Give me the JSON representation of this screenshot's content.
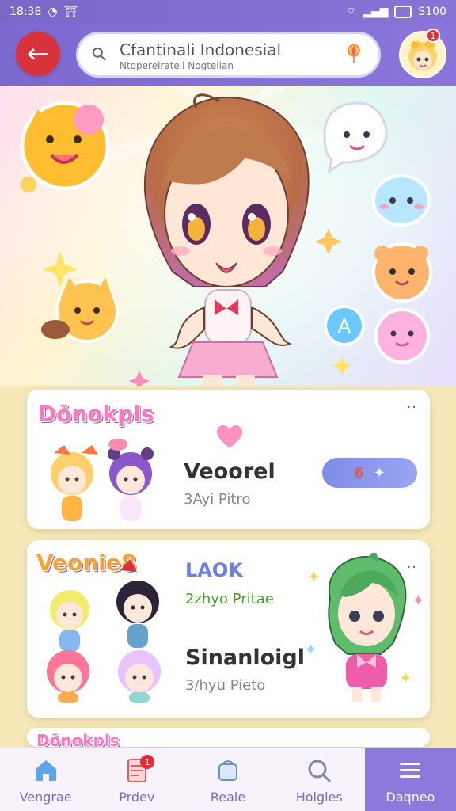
{
  "status": {
    "time": "18:38",
    "left_icons": [
      "chat-icon",
      "notification-icon"
    ],
    "right_text": "S100"
  },
  "topbar": {
    "back_icon": "back-arrow-icon",
    "search_text": "Cfantinali Indonesial",
    "search_subtext": "Ntoperelrateii Nogteiian",
    "search_icon": "search-icon",
    "mic_icon": "microphone-icon",
    "avatar_icon": "avatar-icon",
    "badge_text": "1"
  },
  "hero": {
    "main_character": "anime-girl-illustration",
    "decorations": [
      "sticker-yellow-cat",
      "sticker-ghost",
      "sticker-blue-cloud",
      "sticker-orange-bear",
      "sticker-pink-blob",
      "sticker-letter-a"
    ],
    "letter_badge_text": "A"
  },
  "cards": [
    {
      "logo": "Dōnokpls",
      "menu": "··",
      "heart_icon": "heart-icon",
      "title": "Veoorel",
      "subtitle": "3Ayi Pitro",
      "button_icon": "bookmark-icon",
      "button_symbol": "6"
    },
    {
      "logo": "Veonie8",
      "menu": "··",
      "lock_title": "LAOK",
      "lock_subtitle": "2zhyo Pritae",
      "title": "Sinanloigl",
      "subtitle": "3/hyu Pieto"
    },
    {
      "logo": "Dōnokpls"
    }
  ],
  "bottom_nav": [
    {
      "label": "Vengrae",
      "icon": "home-icon",
      "active": false
    },
    {
      "label": "Prdev",
      "icon": "document-icon",
      "active": false,
      "badge": "1"
    },
    {
      "label": "Reale",
      "icon": "bag-icon",
      "active": false
    },
    {
      "label": "Hoigies",
      "icon": "search-icon",
      "active": false
    },
    {
      "label": "Daqneo",
      "icon": "menu-icon",
      "active": true
    }
  ]
}
